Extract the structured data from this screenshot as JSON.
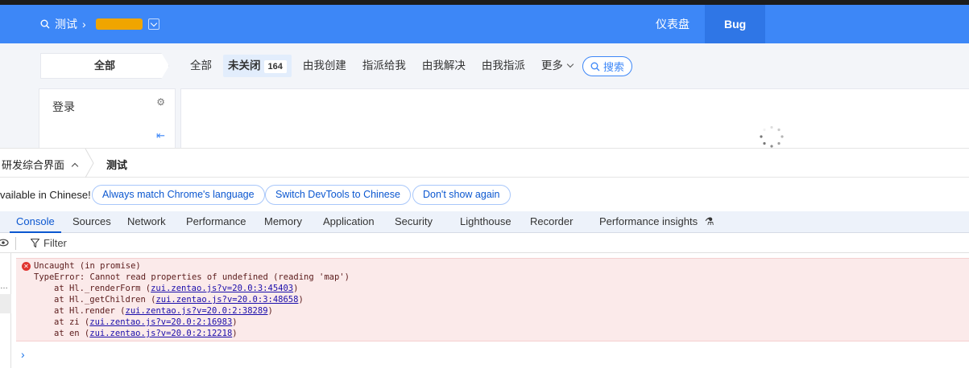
{
  "header": {
    "product": "测试",
    "nav": [
      "仪表盘",
      "Bug"
    ]
  },
  "subbar": {
    "all_label": "全部",
    "tabs": [
      {
        "label": "全部"
      },
      {
        "label": "未关闭",
        "count": "164"
      },
      {
        "label": "由我创建"
      },
      {
        "label": "指派给我"
      },
      {
        "label": "由我解决"
      },
      {
        "label": "由我指派"
      },
      {
        "label": "更多"
      }
    ],
    "search_label": "搜索"
  },
  "side_panel": {
    "title": "登录"
  },
  "devtools": {
    "breadcrumb": [
      "研发综合界面",
      "测试"
    ],
    "lang_notice": "vailable in Chinese!",
    "lang_buttons": [
      "Always match Chrome's language",
      "Switch DevTools to Chinese",
      "Don't show again"
    ],
    "tabs": [
      "Console",
      "Sources",
      "Network",
      "Performance",
      "Memory",
      "Application",
      "Security",
      "Lighthouse",
      "Recorder",
      "Performance insights"
    ],
    "active_tab": "Console",
    "filter_placeholder": "Filter",
    "error": {
      "title": "Uncaught (in promise)",
      "message": "TypeError: Cannot read properties of undefined (reading 'map')",
      "stack": [
        {
          "prefix": "at Hl._renderForm (",
          "link": "zui.zentao.js?v=20.0:3:45403",
          "suffix": ")"
        },
        {
          "prefix": "at Hl._getChildren (",
          "link": "zui.zentao.js?v=20.0:3:48658",
          "suffix": ")"
        },
        {
          "prefix": "at Hl.render (",
          "link": "zui.zentao.js?v=20.0:2:38289",
          "suffix": ")"
        },
        {
          "prefix": "at zi (",
          "link": "zui.zentao.js?v=20.0:2:16983",
          "suffix": ")"
        },
        {
          "prefix": "at en (",
          "link": "zui.zentao.js?v=20.0:2:12218",
          "suffix": ")"
        }
      ]
    },
    "prompt": "›"
  },
  "colors": {
    "header_bg": "#3d87f7",
    "accent": "#0b57d0",
    "error_bg": "#fbeaea"
  }
}
